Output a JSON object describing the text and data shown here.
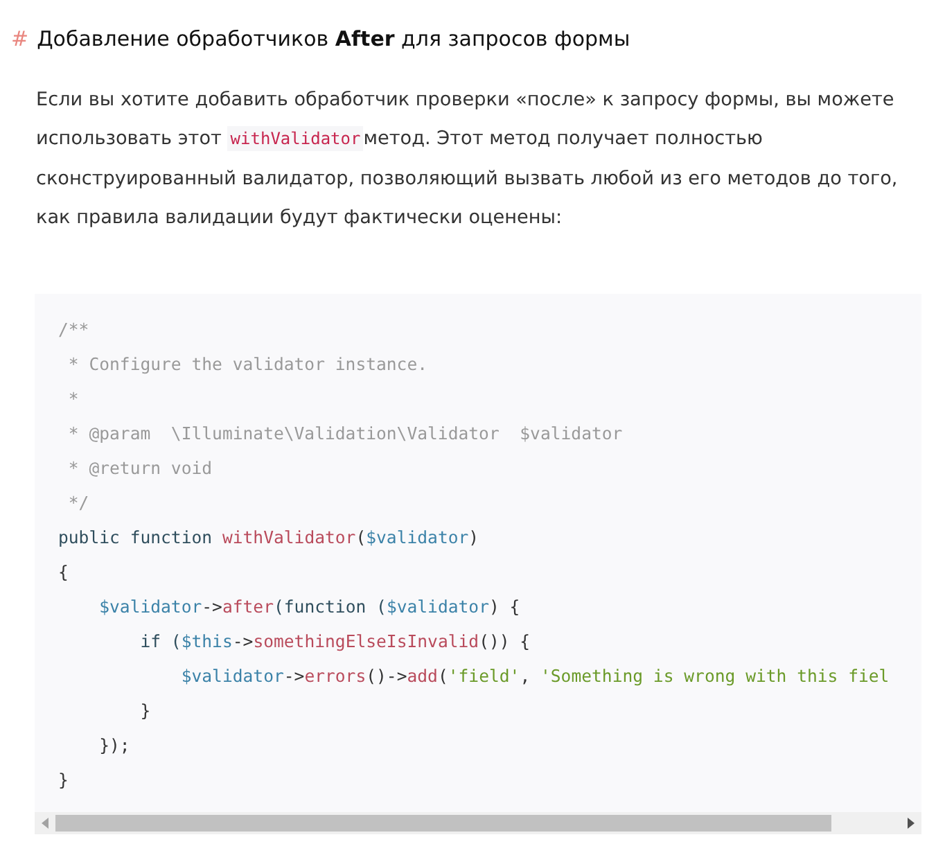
{
  "section": {
    "anchor": "#",
    "heading": "Добавление обработчиков **After** для запросов формы"
  },
  "paragraph": {
    "before": "Если вы хотите добавить обработчик проверки «после» к запросу формы, вы можете использовать этот ",
    "code": "withValidator",
    "after": "метод. Этот метод получает полностью сконструированный валидатор, позволяющий вызвать любой из его методов до того, как правила валидации будут фактически оценены:"
  },
  "code_lines": [
    [
      {
        "text": "/**",
        "kind": "comment"
      }
    ],
    [
      {
        "text": " * Configure the validator instance.",
        "kind": "comment"
      }
    ],
    [
      {
        "text": " *",
        "kind": "comment"
      }
    ],
    [
      {
        "text": " * @param  \\Illuminate\\Validation\\Validator  $validator",
        "kind": "comment"
      }
    ],
    [
      {
        "text": " * @return void",
        "kind": "comment"
      }
    ],
    [
      {
        "text": " */",
        "kind": "comment"
      }
    ],
    [
      {
        "text": "public function ",
        "kind": "keyword"
      },
      {
        "text": "withValidator",
        "kind": "func"
      },
      {
        "text": "(",
        "kind": "plain"
      },
      {
        "text": "$validator",
        "kind": "var"
      },
      {
        "text": ")",
        "kind": "plain"
      }
    ],
    [
      {
        "text": "{",
        "kind": "plain"
      }
    ],
    [
      {
        "text": "    $validator",
        "kind": "var"
      },
      {
        "text": "->",
        "kind": "plain"
      },
      {
        "text": "after",
        "kind": "func"
      },
      {
        "text": "(function (",
        "kind": "keyword"
      },
      {
        "text": "$validator",
        "kind": "var"
      },
      {
        "text": ") {",
        "kind": "plain"
      }
    ],
    [
      {
        "text": "        if (",
        "kind": "keyword"
      },
      {
        "text": "$this",
        "kind": "var"
      },
      {
        "text": "->",
        "kind": "plain"
      },
      {
        "text": "somethingElseIsInvalid",
        "kind": "func"
      },
      {
        "text": "()) {",
        "kind": "plain"
      }
    ],
    [
      {
        "text": "            $validator",
        "kind": "var"
      },
      {
        "text": "->",
        "kind": "plain"
      },
      {
        "text": "errors",
        "kind": "func"
      },
      {
        "text": "()->",
        "kind": "plain"
      },
      {
        "text": "add",
        "kind": "func"
      },
      {
        "text": "(",
        "kind": "plain"
      },
      {
        "text": "'field'",
        "kind": "string"
      },
      {
        "text": ", ",
        "kind": "plain"
      },
      {
        "text": "'Something is wrong with this fiel",
        "kind": "string"
      }
    ],
    [
      {
        "text": "        }",
        "kind": "plain"
      }
    ],
    [
      {
        "text": "    });",
        "kind": "plain"
      }
    ],
    [
      {
        "text": "}",
        "kind": "plain"
      }
    ]
  ]
}
